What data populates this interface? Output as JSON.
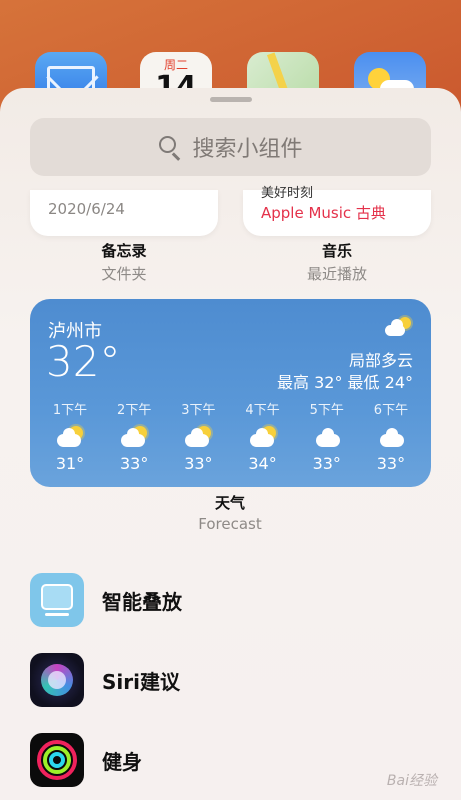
{
  "home": {
    "calendar_day": "周二",
    "calendar_date": "14"
  },
  "search": {
    "placeholder": "搜索小组件"
  },
  "notes_widget": {
    "date": "2020/6/24",
    "title": "备忘录",
    "subtitle": "文件夹"
  },
  "music_widget": {
    "track": "美好时刻",
    "source": "Apple Music 古典",
    "title": "音乐",
    "subtitle": "最近播放"
  },
  "weather_widget": {
    "city": "泸州市",
    "temp": "32°",
    "condition": "局部多云",
    "range": "最高 32° 最低 24°",
    "hours": [
      {
        "time": "1下午",
        "temp": "31°",
        "icon": "partly-cloudy-icon"
      },
      {
        "time": "2下午",
        "temp": "33°",
        "icon": "partly-cloudy-icon"
      },
      {
        "time": "3下午",
        "temp": "33°",
        "icon": "partly-cloudy-icon"
      },
      {
        "time": "4下午",
        "temp": "34°",
        "icon": "partly-cloudy-icon"
      },
      {
        "time": "5下午",
        "temp": "33°",
        "icon": "cloud-icon"
      },
      {
        "time": "6下午",
        "temp": "33°",
        "icon": "cloud-icon"
      }
    ],
    "title": "天气",
    "subtitle": "Forecast"
  },
  "list": [
    {
      "label": "智能叠放",
      "icon": "smart-stack-icon"
    },
    {
      "label": "Siri建议",
      "icon": "siri-icon"
    },
    {
      "label": "健身",
      "icon": "fitness-icon"
    }
  ],
  "watermark": "Bai经验"
}
